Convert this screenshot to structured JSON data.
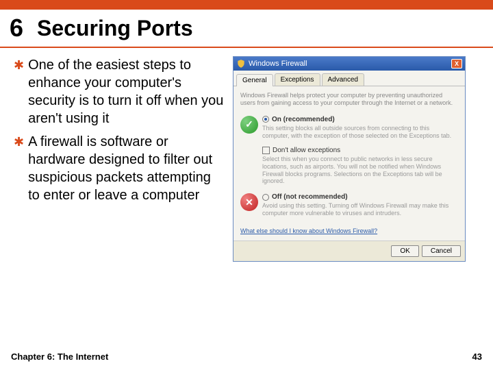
{
  "chapter_number": "6",
  "slide_title": "Securing Ports",
  "bullets": [
    "One of the easiest steps to enhance your computer's security is to turn it off when you aren't using it",
    "A firewall is software or hardware designed to filter out suspicious packets attempting to enter or leave a computer"
  ],
  "dialog": {
    "title": "Windows Firewall",
    "tabs": [
      "General",
      "Exceptions",
      "Advanced"
    ],
    "intro": "Windows Firewall helps protect your computer by preventing unauthorized users from gaining access to your computer through the Internet or a network.",
    "option_on": {
      "label": "On (recommended)",
      "desc": "This setting blocks all outside sources from connecting to this computer, with the exception of those selected on the Exceptions tab."
    },
    "checkbox_label": "Don't allow exceptions",
    "checkbox_desc": "Select this when you connect to public networks in less secure locations, such as airports. You will not be notified when Windows Firewall blocks programs. Selections on the Exceptions tab will be ignored.",
    "option_off": {
      "label": "Off (not recommended)",
      "desc": "Avoid using this setting. Turning off Windows Firewall may make this computer more vulnerable to viruses and intruders."
    },
    "link": "What else should I know about Windows Firewall?",
    "ok": "OK",
    "cancel": "Cancel"
  },
  "footer_left": "Chapter 6: The Internet",
  "footer_right": "43"
}
